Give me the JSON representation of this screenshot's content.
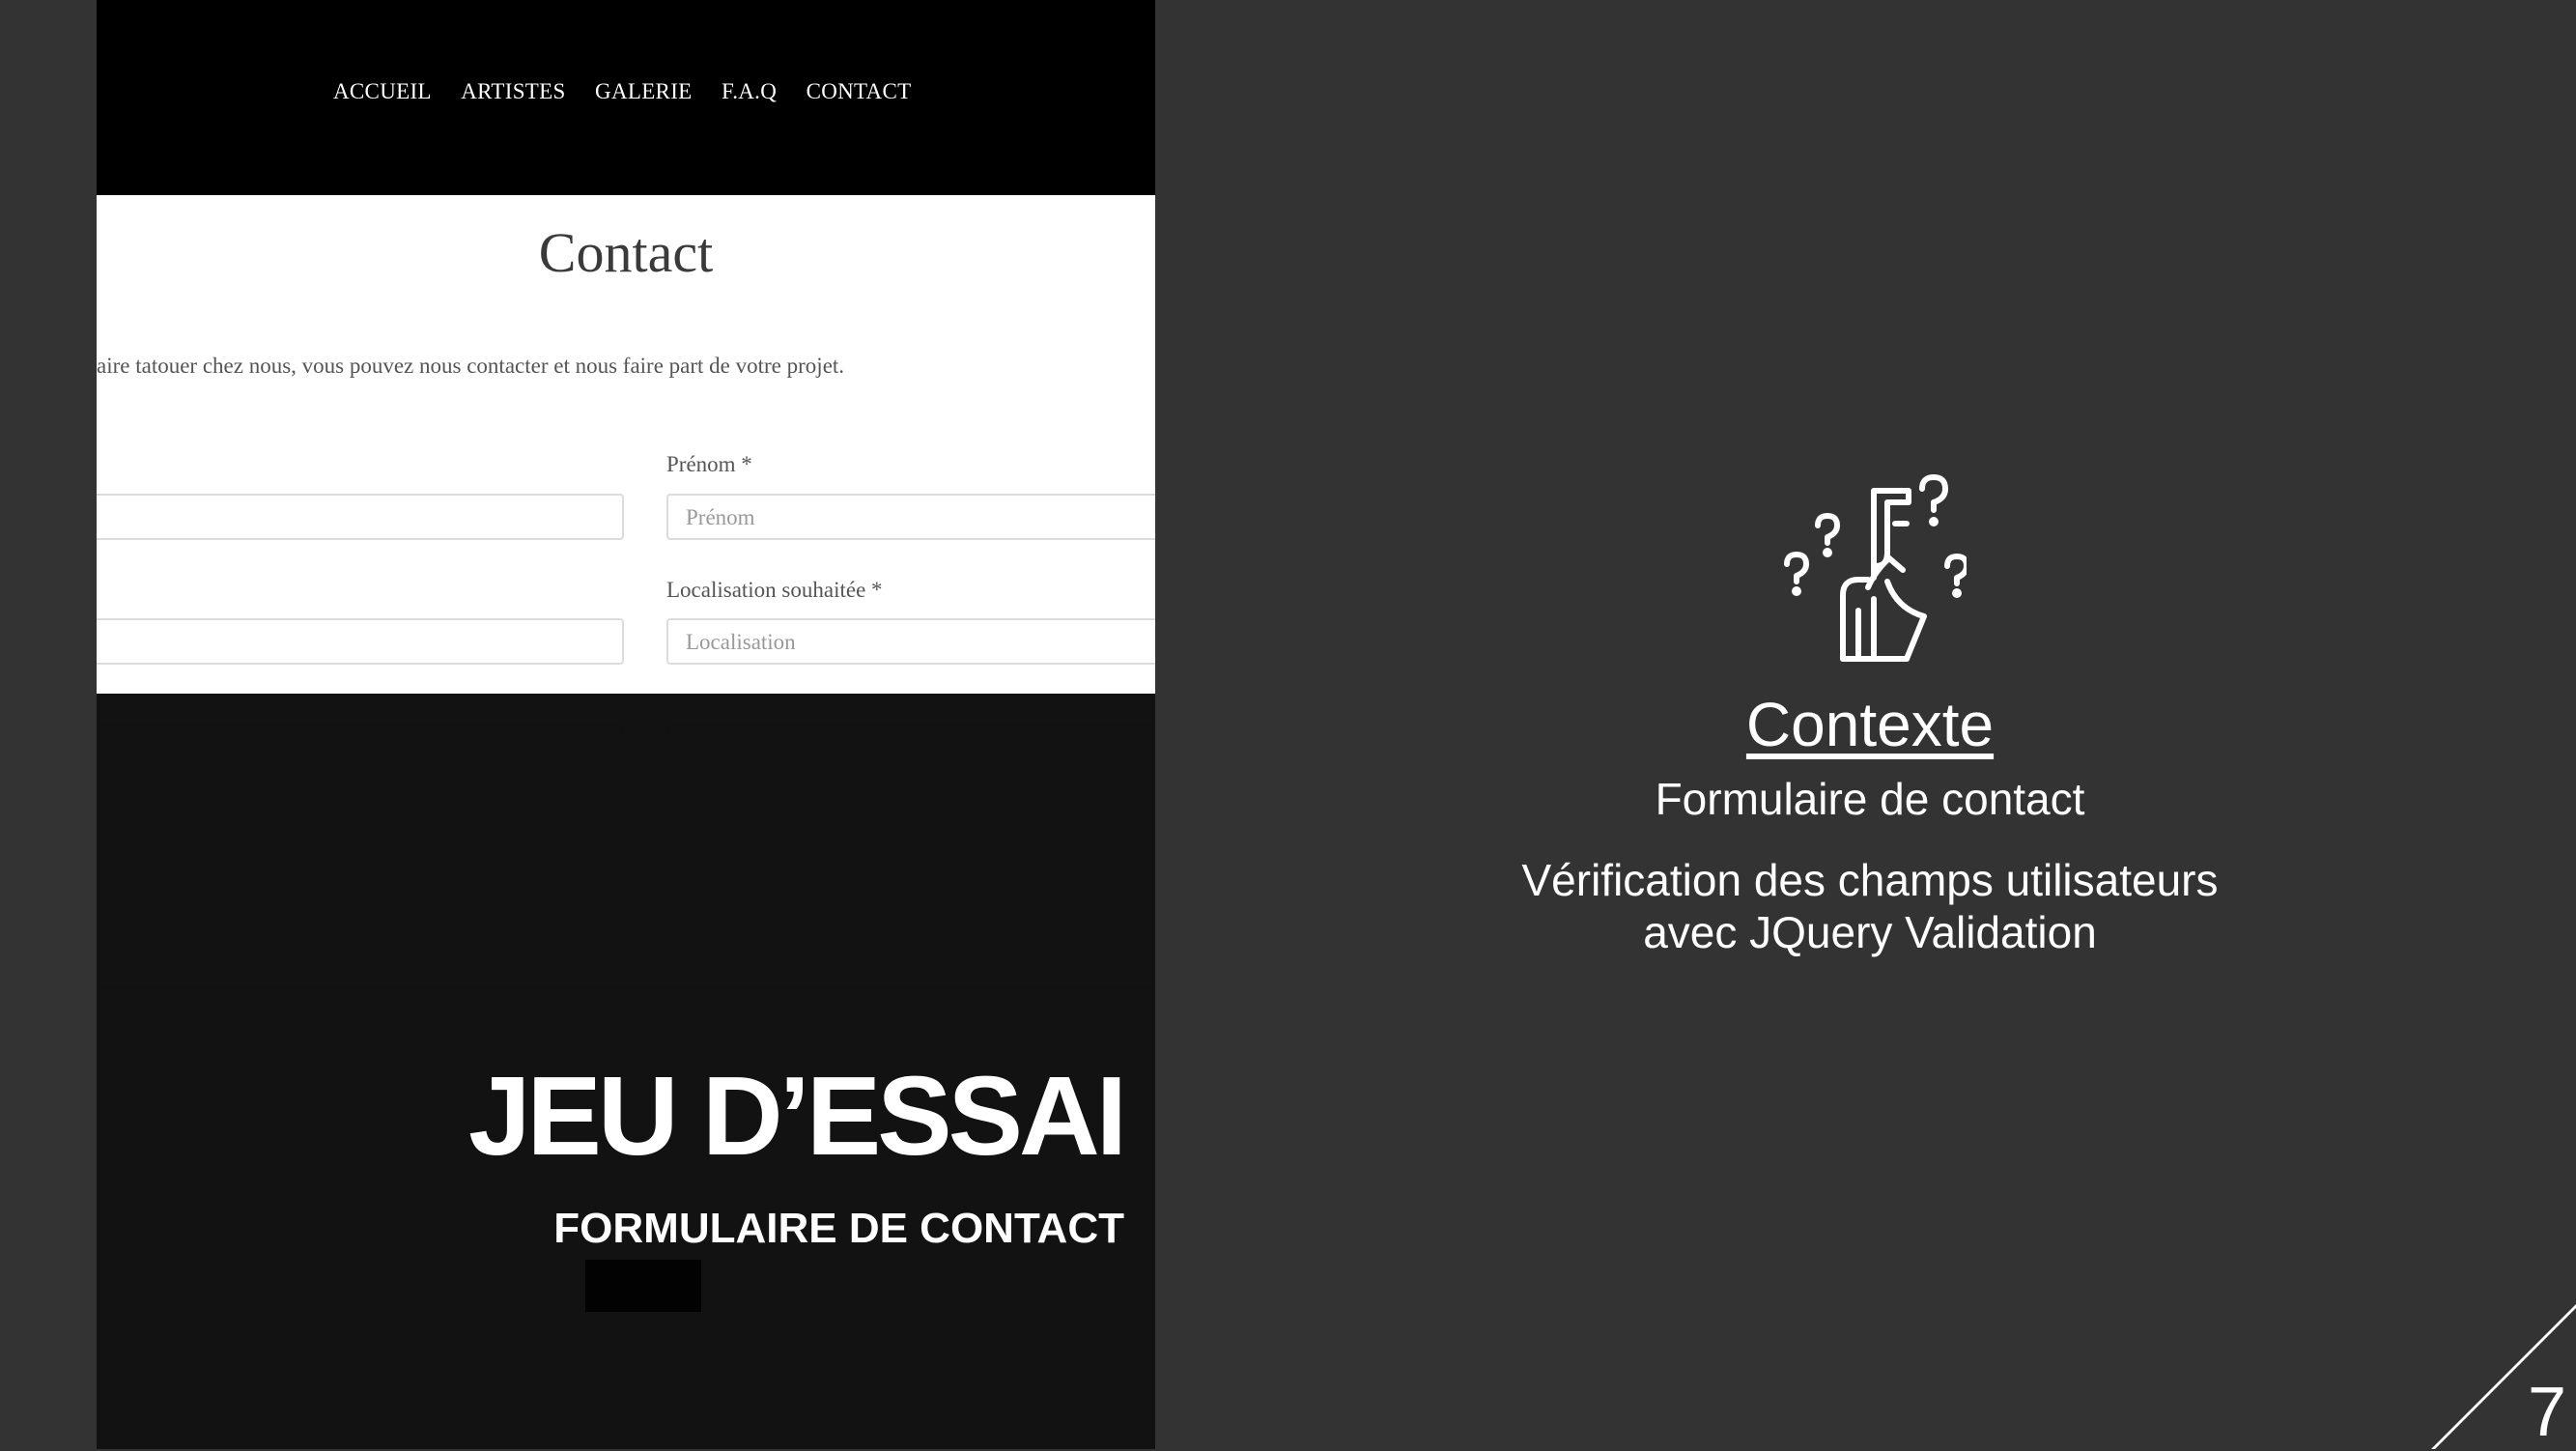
{
  "site": {
    "nav": [
      "ACCUEIL",
      "ARTISTES",
      "GALERIE",
      "F.A.Q",
      "CONTACT"
    ],
    "page_title": "Contact",
    "intro": "aire tatouer chez nous, vous pouvez nous contacter et nous faire part de votre projet.",
    "labels": {
      "prenom": "Prénom *",
      "localisation": "Localisation souhaitée *"
    },
    "placeholders": {
      "prenom": "Prénom",
      "localisation": "Localisation"
    }
  },
  "slide": {
    "title": "JEU D’ESSAI",
    "subtitle": "FORMULAIRE DE CONTACT"
  },
  "context": {
    "icon": "thinking-person-icon",
    "heading": "Contexte",
    "line1": "Formulaire de contact",
    "line2a": "Vérification des champs utilisateurs",
    "line2b": "avec JQuery Validation"
  },
  "page_number": "7",
  "colors": {
    "slide_background": "#333333",
    "site_nav": "#000000",
    "text": "#ffffff"
  }
}
